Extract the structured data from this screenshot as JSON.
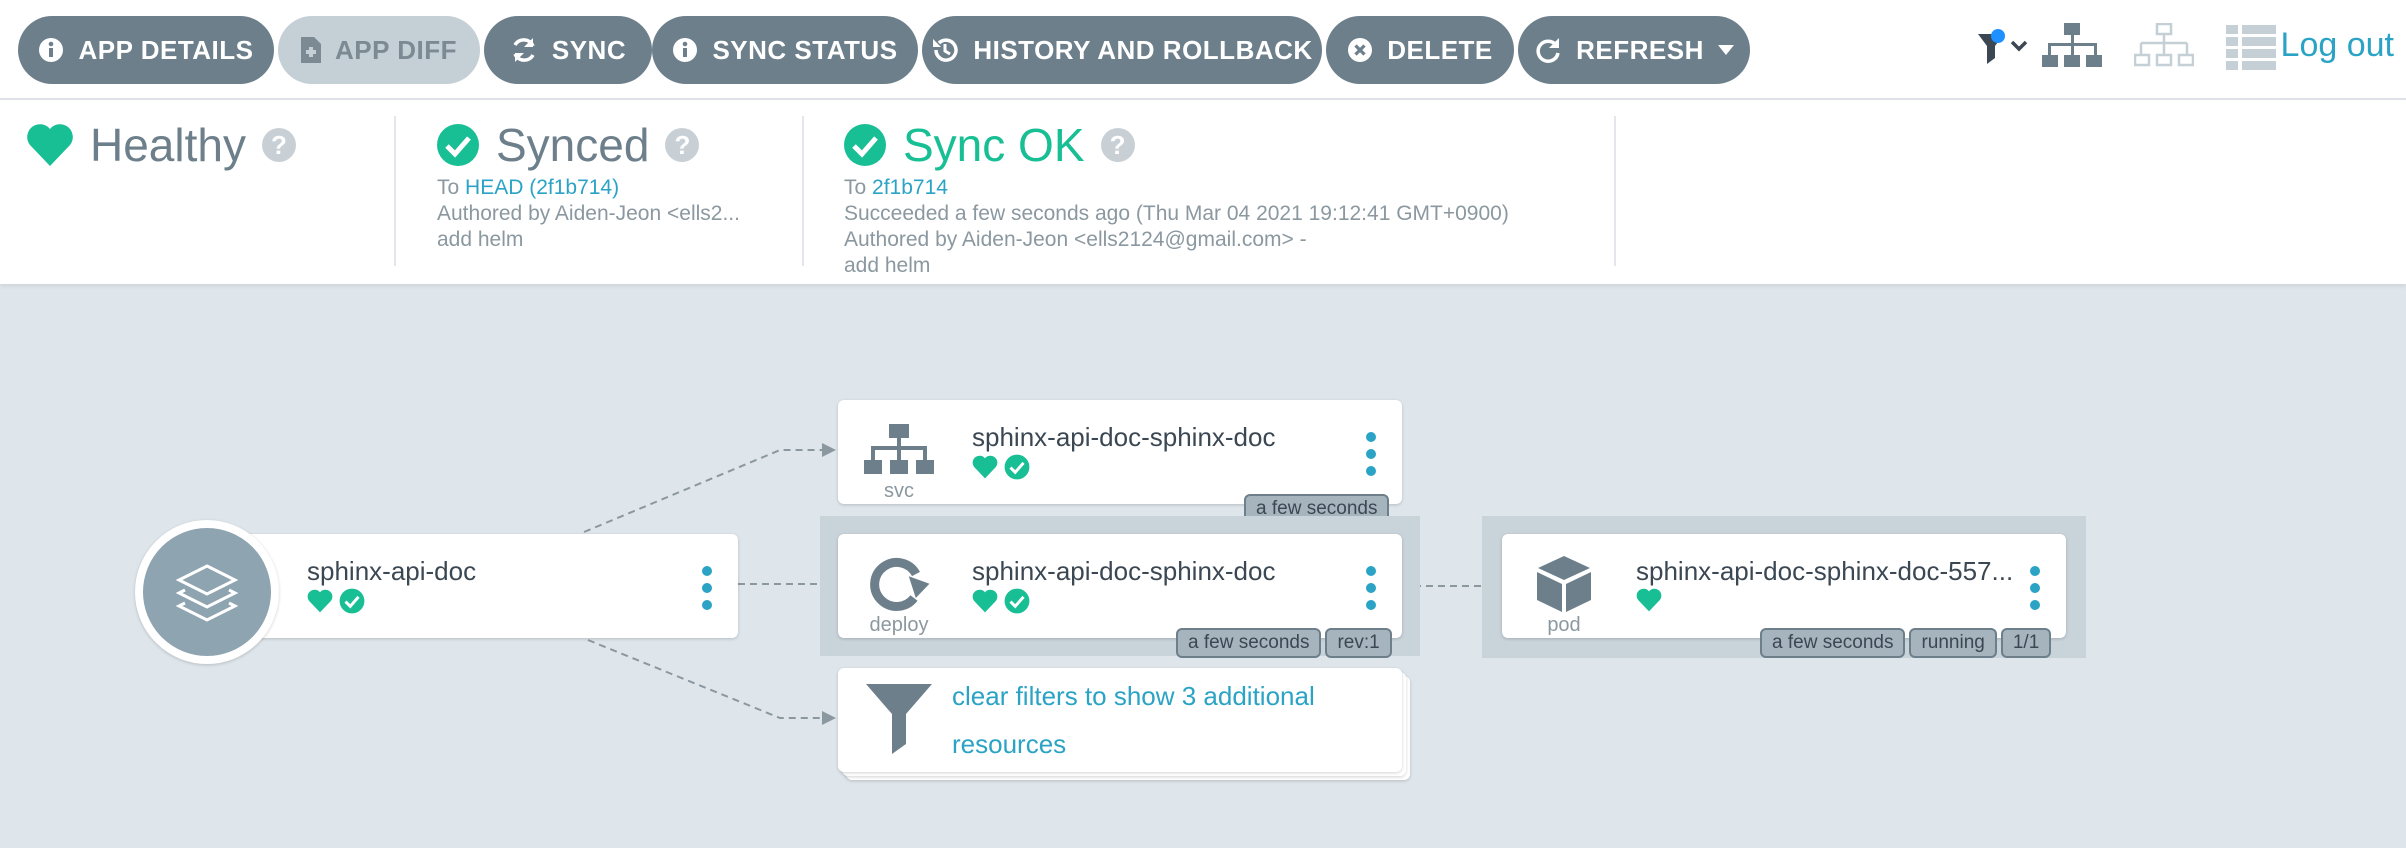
{
  "toolbar": {
    "buttons": [
      {
        "label": "APP DETAILS",
        "icon": "info-circle-icon"
      },
      {
        "label": "APP DIFF",
        "icon": "file-diff-icon"
      },
      {
        "label": "SYNC",
        "icon": "sync-icon"
      },
      {
        "label": "SYNC STATUS",
        "icon": "info-circle-icon"
      },
      {
        "label": "HISTORY AND ROLLBACK",
        "icon": "history-icon"
      },
      {
        "label": "DELETE",
        "icon": "close-circle-icon"
      },
      {
        "label": "REFRESH",
        "icon": "refresh-icon"
      }
    ],
    "view_icons": [
      "filter-icon",
      "tree-view-icon",
      "network-view-icon",
      "list-view-icon"
    ],
    "logout_label": "Log out"
  },
  "status": {
    "health": {
      "label": "Healthy"
    },
    "sync": {
      "label": "Synced",
      "to_prefix": "To",
      "revision_link": "HEAD (2f1b714)",
      "author": "Authored by Aiden-Jeon <ells2...",
      "message": "add helm"
    },
    "operation": {
      "label": "Sync OK",
      "to_prefix": "To",
      "revision_link": "2f1b714",
      "succeeded": "Succeeded a few seconds ago (Thu Mar 04 2021 19:12:41 GMT+0900)",
      "author": "Authored by Aiden-Jeon <ells2124@gmail.com> -",
      "message": "add helm"
    }
  },
  "graph": {
    "app": {
      "name": "sphinx-api-doc"
    },
    "svc": {
      "name": "sphinx-api-doc-sphinx-doc",
      "kind": "svc",
      "age": "a few seconds"
    },
    "deploy": {
      "name": "sphinx-api-doc-sphinx-doc",
      "kind": "deploy",
      "age": "a few seconds",
      "rev": "rev:1"
    },
    "pod": {
      "name": "sphinx-api-doc-sphinx-doc-557...",
      "kind": "pod",
      "age": "a few seconds",
      "state": "running",
      "ready": "1/1"
    },
    "filter": {
      "text": "clear filters to show 3 additional resources"
    }
  },
  "colors": {
    "accent": "#2aa3c5",
    "healthy": "#18be94",
    "button": "#6d7f8b"
  }
}
